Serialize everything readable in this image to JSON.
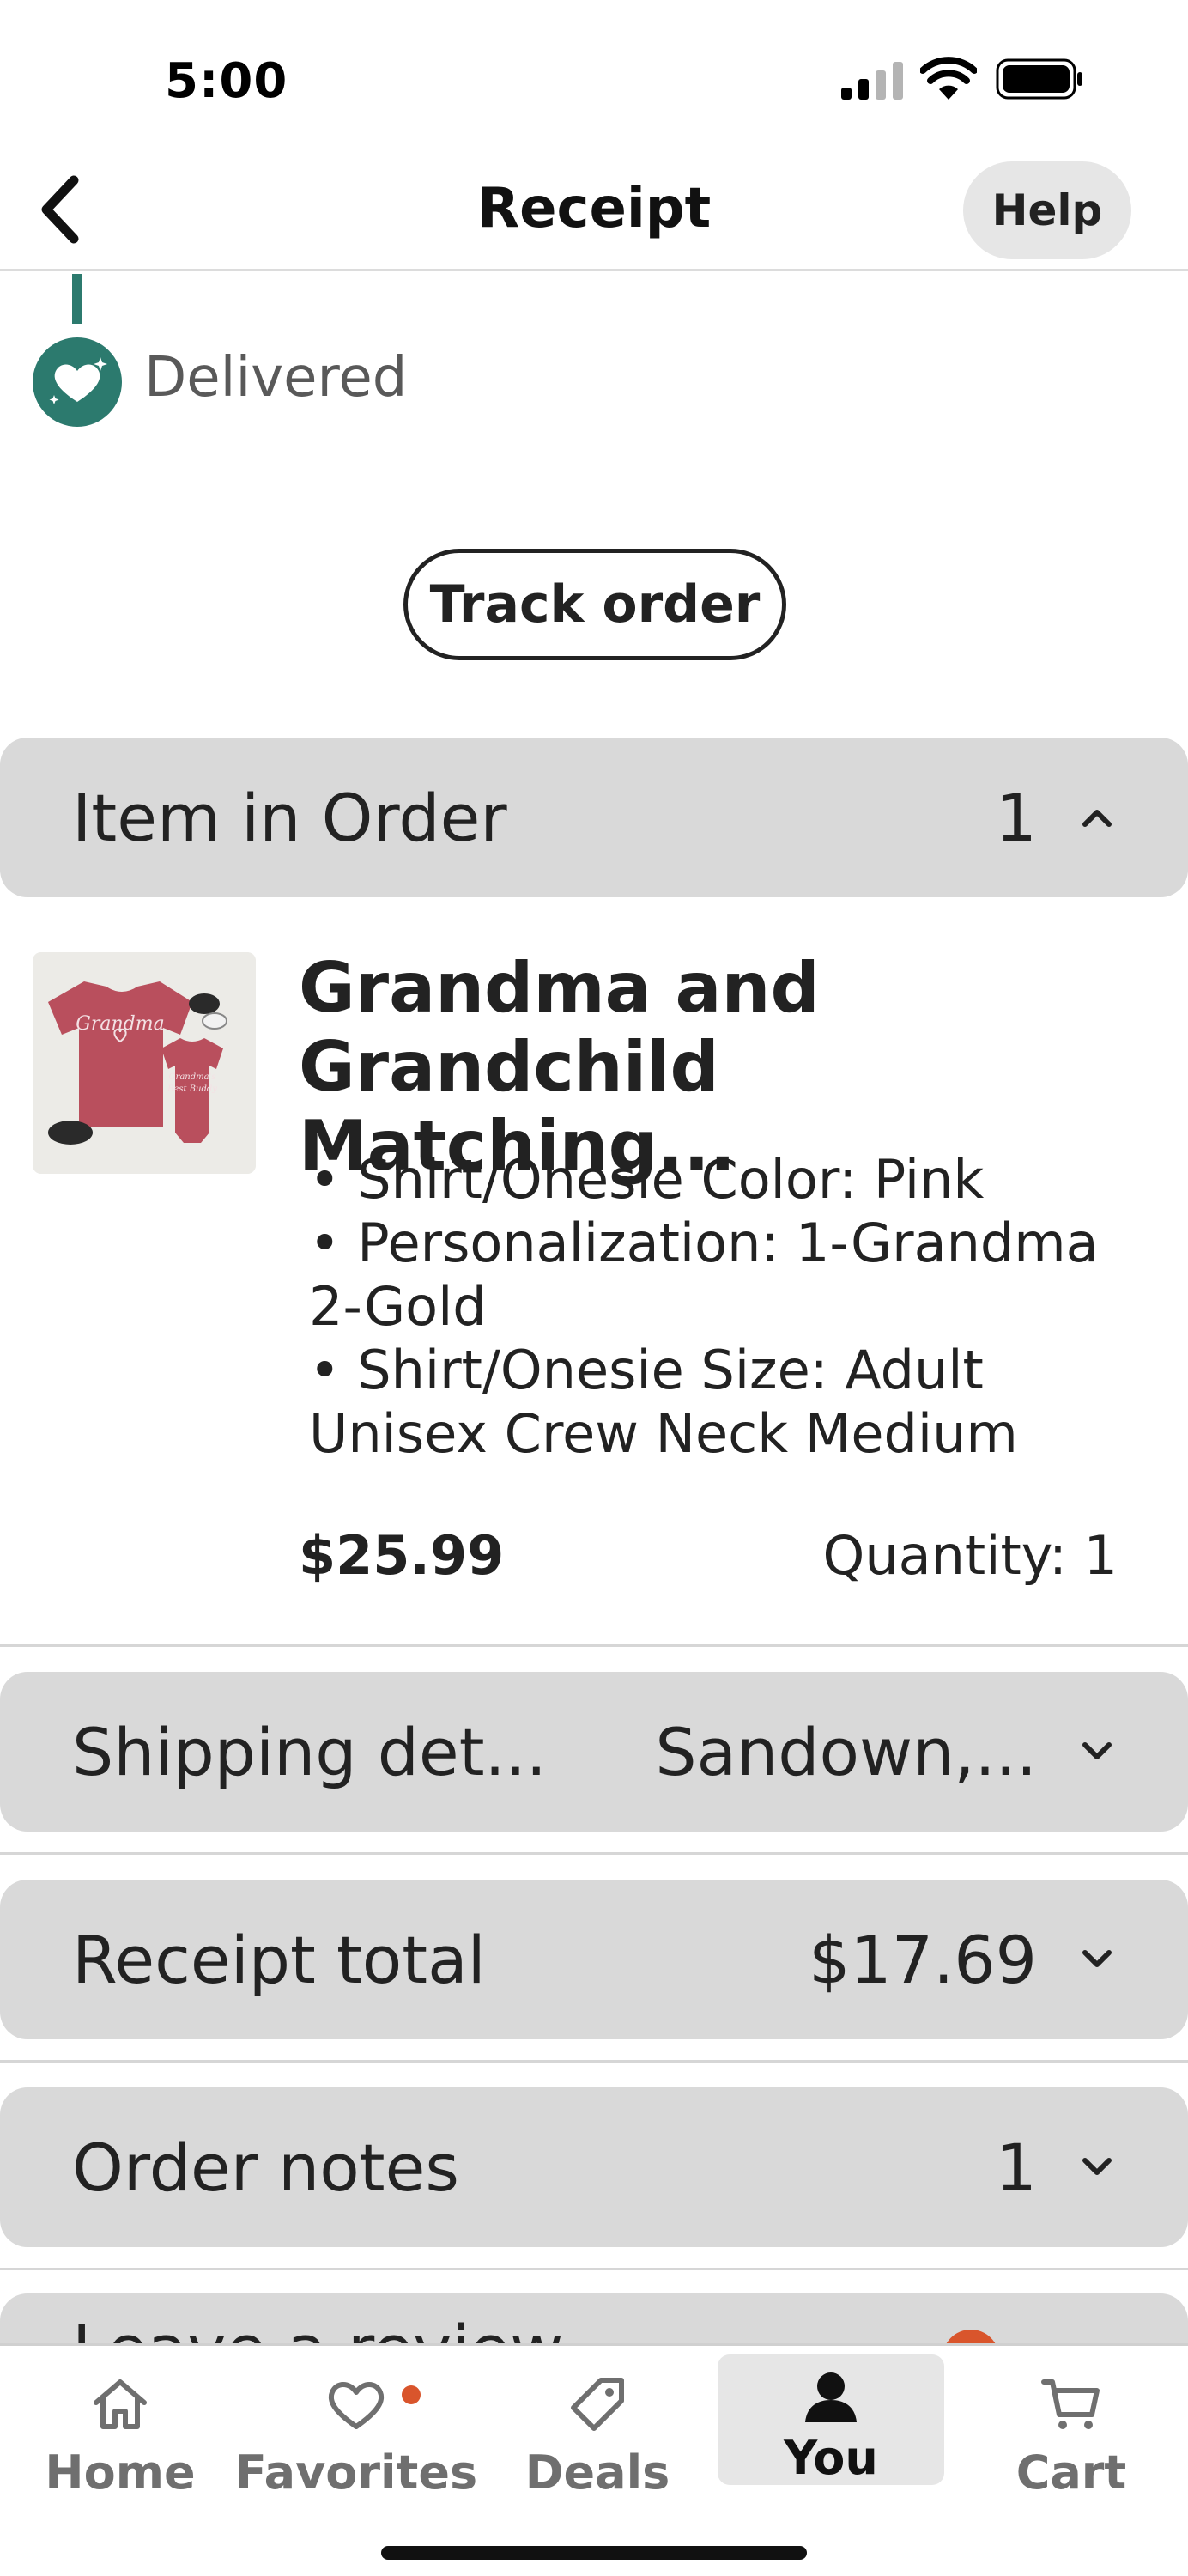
{
  "status_bar": {
    "time": "5:00"
  },
  "header": {
    "title": "Receipt",
    "help_label": "Help"
  },
  "order_status": {
    "label": "Delivered",
    "track_button_label": "Track order"
  },
  "items_section": {
    "label": "Item in Order",
    "count": "1"
  },
  "item": {
    "title": "Grandma and Grandchild Matching...",
    "specs": [
      "• Shirt/Onesie Color: Pink",
      "• Personalization:  1-Grandma 2-Gold",
      "• Shirt/Onesie Size: Adult Unisex Crew Neck Medium"
    ],
    "price": "$25.99",
    "quantity": "Quantity: 1"
  },
  "shipping_section": {
    "label": "Shipping det...",
    "value": "Sandown,..."
  },
  "receipt_section": {
    "label": "Receipt total",
    "value": "$17.69"
  },
  "notes_section": {
    "label": "Order notes",
    "count": "1"
  },
  "review_section": {
    "label": "Leave a review"
  },
  "tab_bar": {
    "tabs": [
      {
        "label": "Home",
        "icon": "home-icon"
      },
      {
        "label": "Favorites",
        "icon": "heart-icon"
      },
      {
        "label": "Deals",
        "icon": "tag-icon"
      },
      {
        "label": "You",
        "icon": "person-icon"
      },
      {
        "label": "Cart",
        "icon": "cart-icon"
      }
    ],
    "active": "You"
  },
  "colors": {
    "accent_green": "#2c7a6e",
    "notification_orange": "#d9552c",
    "section_gray": "#d9d9d9"
  }
}
